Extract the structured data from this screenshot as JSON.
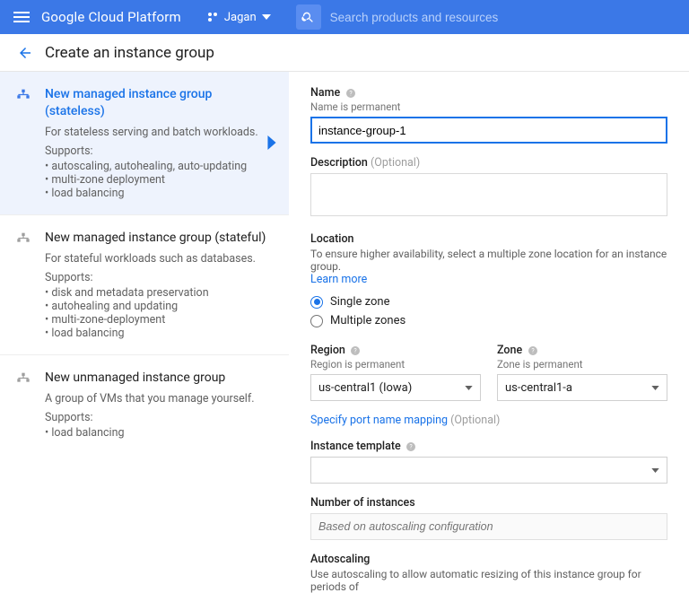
{
  "header": {
    "brand": "Google Cloud Platform",
    "project_name": "Jagan",
    "search_placeholder": "Search products and resources"
  },
  "page": {
    "title": "Create an instance group"
  },
  "sidebar": {
    "options": [
      {
        "title": "New managed instance group (stateless)",
        "subtitle": "For stateless serving and batch workloads.",
        "supports_label": "Supports:",
        "supports": [
          "autoscaling, autohealing, auto-updating",
          "multi-zone deployment",
          "load balancing"
        ]
      },
      {
        "title": "New managed instance group (stateful)",
        "subtitle": "For stateful workloads such as databases.",
        "supports_label": "Supports:",
        "supports": [
          "disk and metadata preservation",
          "autohealing and updating",
          "multi-zone-deployment",
          "load balancing"
        ]
      },
      {
        "title": "New unmanaged instance group",
        "subtitle": "A group of VMs that you manage yourself.",
        "supports_label": "Supports:",
        "supports": [
          "load balancing"
        ]
      }
    ]
  },
  "form": {
    "name_label": "Name",
    "name_sub": "Name is permanent",
    "name_value": "instance-group-1",
    "description_label": "Description",
    "description_optional": "(Optional)",
    "location_label": "Location",
    "location_desc": "To ensure higher availability, select a multiple zone location for an instance group.",
    "learn_more": "Learn more",
    "single_zone": "Single zone",
    "multiple_zones": "Multiple zones",
    "region_label": "Region",
    "region_sub": "Region is permanent",
    "region_value": "us-central1 (Iowa)",
    "zone_label": "Zone",
    "zone_sub": "Zone is permanent",
    "zone_value": "us-central1-a",
    "port_mapping": "Specify port name mapping",
    "port_mapping_optional": "(Optional)",
    "instance_template_label": "Instance template",
    "num_instances_label": "Number of instances",
    "num_instances_placeholder": "Based on autoscaling configuration",
    "autoscaling_label": "Autoscaling",
    "autoscaling_desc": "Use autoscaling to allow automatic resizing of this instance group for periods of"
  }
}
